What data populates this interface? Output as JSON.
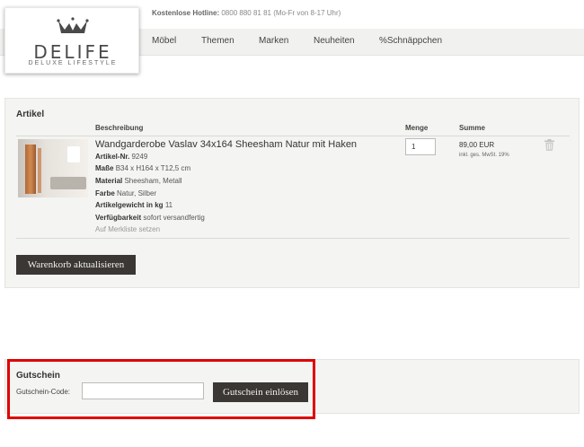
{
  "header": {
    "hotline_label": "Kostenlose Hotline:",
    "hotline_text": "0800 880 81 81 (Mo-Fr von 8-17 Uhr)",
    "logo_text": "DELIFE",
    "logo_subtitle": "DELUXE LIFESTYLE",
    "nav": [
      "Möbel",
      "Themen",
      "Marken",
      "Neuheiten",
      "%Schnäppchen"
    ]
  },
  "cart": {
    "title": "Artikel",
    "columns": {
      "description": "Beschreibung",
      "quantity": "Menge",
      "total": "Summe"
    },
    "item": {
      "name": "Wandgarderobe Vaslav 34x164 Sheesham Natur mit Haken",
      "article_no_label": "Artikel-Nr.",
      "article_no": "9249",
      "dimensions_label": "Maße",
      "dimensions": "B34 x H164 x T12,5 cm",
      "material_label": "Material",
      "material": "Sheesham, Metall",
      "color_label": "Farbe",
      "color": "Natur, Silber",
      "weight_label": "Artikelgewicht in kg",
      "weight": "11",
      "availability_label": "Verfügbarkeit",
      "availability": "sofort versandfertig",
      "wishlist_link": "Auf Merkliste setzen",
      "quantity": "1",
      "price": "89,00 EUR",
      "tax_note": "inkl. ges. MwSt. 19%",
      "image_icon": "product-photo",
      "delete_icon": "trash-icon"
    },
    "update_button": "Warenkorb aktualisieren"
  },
  "voucher": {
    "title": "Gutschein",
    "code_label": "Gutschein-Code:",
    "code_value": "",
    "redeem_button": "Gutschein einlösen"
  },
  "colors": {
    "highlight": "#e00000",
    "button_bg": "#3a3734",
    "panel_bg": "#f4f4f2"
  }
}
